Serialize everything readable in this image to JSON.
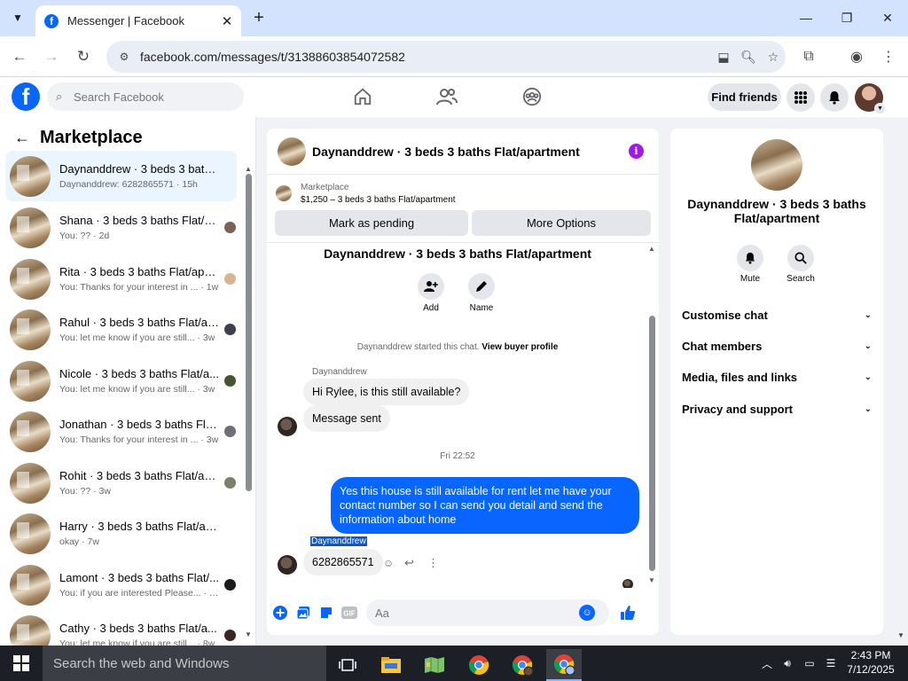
{
  "browser": {
    "tab_title": "Messenger | Facebook",
    "url": "facebook.com/messages/t/31388603854072582"
  },
  "fb": {
    "logo": "f",
    "search_placeholder": "Search Facebook",
    "find_friends": "Find friends",
    "brand_color": "#0866ff"
  },
  "sidebar": {
    "title": "Marketplace",
    "conversations": [
      {
        "name": "Daynanddrew · 3 beds 3 baths F...",
        "preview": "Daynanddrew: 6282865571 · 15h",
        "active": true
      },
      {
        "name": "Shana · 3 beds 3 baths Flat/a...",
        "preview": "You: ?? · 2d"
      },
      {
        "name": "Rita · 3 beds 3 baths Flat/apa...",
        "preview": "You: Thanks for your interest in ... · 1w"
      },
      {
        "name": "Rahul · 3 beds 3 baths Flat/ap...",
        "preview": "You: let me know if you are still... · 3w"
      },
      {
        "name": "Nicole · 3 beds 3 baths Flat/a...",
        "preview": "You: let me know if you are still... · 3w"
      },
      {
        "name": "Jonathan · 3 beds 3 baths Fla...",
        "preview": "You: Thanks for your interest in ... · 3w"
      },
      {
        "name": "Rohit · 3 beds 3 baths Flat/ap...",
        "preview": "You: ?? · 3w"
      },
      {
        "name": "Harry · 3 beds 3 baths Flat/apar...",
        "preview": "okay · 7w"
      },
      {
        "name": "Lamont · 3 beds 3 baths Flat/...",
        "preview": "You: if you are interested Please... · 8w"
      },
      {
        "name": "Cathy · 3 beds 3 baths Flat/a...",
        "preview": "You: let me know if you are still... · 8w"
      }
    ]
  },
  "chat": {
    "header_name": "Daynanddrew · 3 beds 3 baths Flat/apartment",
    "listing_source": "Marketplace",
    "listing_title": "$1,250 – 3 beds 3 baths Flat/apartment",
    "mark_pending": "Mark as pending",
    "more_options": "More Options",
    "body_title": "Daynanddrew · 3 beds 3 baths Flat/apartment",
    "add_label": "Add",
    "name_label": "Name",
    "started_text": "Daynanddrew started this chat.",
    "view_profile": "View buyer profile",
    "sender": "Daynanddrew",
    "msg1": "Hi Rylee, is this still available?",
    "msg2": "Message sent",
    "timestamp": "Fri 22:52",
    "my_msg": "Yes this house is still available for rent let me have your contact number so I can send you detail and send the information about home",
    "sender2": "Daynanddrew",
    "msg3": "6282865571",
    "composer_placeholder": "Aa"
  },
  "right": {
    "name": "Daynanddrew · 3 beds 3 baths Flat/apartment",
    "mute": "Mute",
    "search": "Search",
    "items": [
      "Customise chat",
      "Chat members",
      "Media, files and links",
      "Privacy and support"
    ]
  },
  "taskbar": {
    "search_placeholder": "Search the web and Windows",
    "time": "2:43 PM",
    "date": "7/12/2025"
  }
}
